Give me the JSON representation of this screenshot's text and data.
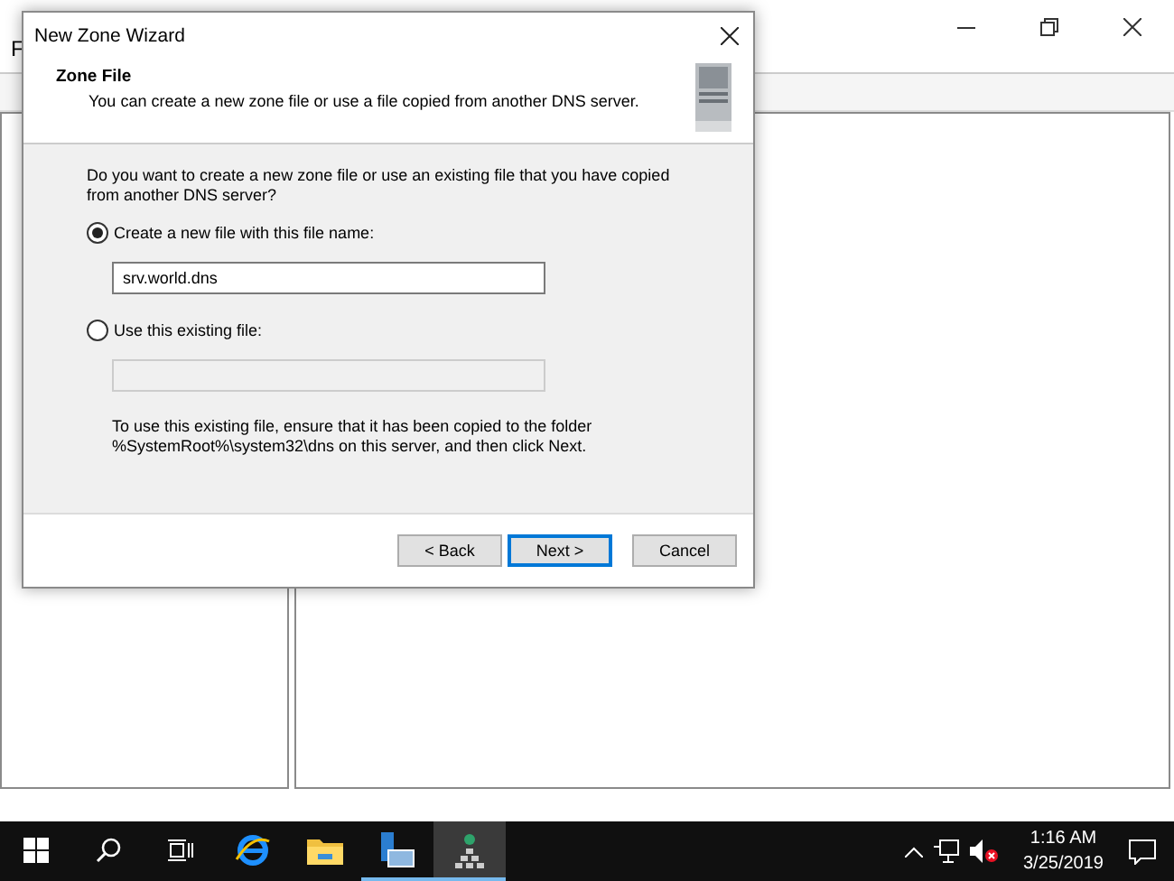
{
  "background_window": {
    "menu_letter": "F"
  },
  "dialog": {
    "title": "New Zone Wizard",
    "heading": "Zone File",
    "subtitle": "You can create a new zone file or use a file copied from another DNS server.",
    "question": "Do you want to create a new zone file or use an existing file that you have copied from another DNS server?",
    "options": [
      {
        "label": "Create a new file with this file name:",
        "selected": true,
        "field_value": "srv.world.dns",
        "field_disabled": false
      },
      {
        "label": "Use this existing file:",
        "selected": false,
        "field_disabled": true
      }
    ],
    "note": "To use this existing file, ensure that it has been copied to the folder %SystemRoot%\\system32\\dns on this server, and then click Next.",
    "buttons": [
      {
        "label": "< Back",
        "default": false
      },
      {
        "label": "Next >",
        "default": true
      },
      {
        "label": "Cancel",
        "default": false
      }
    ]
  },
  "taskbar": {
    "apps": [
      {
        "kind": "ie",
        "running": false,
        "active": false
      },
      {
        "kind": "folder",
        "running": false,
        "active": false
      },
      {
        "kind": "server",
        "running": true,
        "active": false
      },
      {
        "kind": "dns",
        "running": true,
        "active": true
      }
    ],
    "time": "1:16 AM",
    "date": "3/25/2019"
  }
}
